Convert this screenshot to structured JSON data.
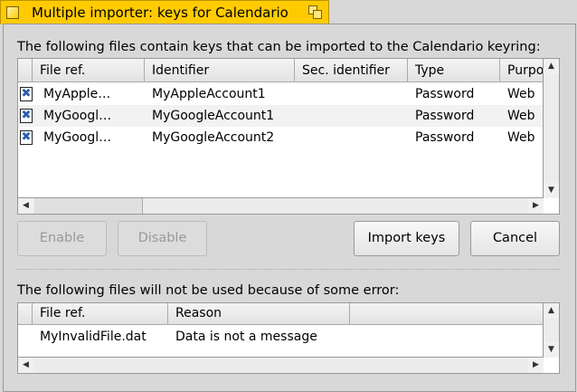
{
  "window": {
    "title": "Multiple importer: keys for Calendario",
    "accent": "#ffcb00"
  },
  "import_section": {
    "label": "The following files contain keys that can be imported to the Calendario keyring:",
    "columns": [
      "File ref.",
      "Identifier",
      "Sec. identifier",
      "Type",
      "Purpose"
    ],
    "columns_visible": [
      "File ref.",
      "Identifier",
      "Sec. identifier",
      "Type",
      "Purpo"
    ],
    "rows": [
      {
        "checked": true,
        "file_ref": "MyApple…",
        "identifier": "MyAppleAccount1",
        "sec_identifier": "",
        "type": "Password",
        "purpose": "Web"
      },
      {
        "checked": true,
        "file_ref": "MyGoogl…",
        "identifier": "MyGoogleAccount1",
        "sec_identifier": "",
        "type": "Password",
        "purpose": "Web"
      },
      {
        "checked": true,
        "file_ref": "MyGoogl…",
        "identifier": "MyGoogleAccount2",
        "sec_identifier": "",
        "type": "Password",
        "purpose": "Web"
      }
    ]
  },
  "buttons": {
    "enable": "Enable",
    "disable": "Disable",
    "import": "Import keys",
    "cancel": "Cancel"
  },
  "error_section": {
    "label": "The following files will not be used because of some error:",
    "columns": [
      "File ref.",
      "Reason"
    ],
    "rows": [
      {
        "file_ref": "MyInvalidFile.dat",
        "reason": "Data is not a message"
      }
    ]
  }
}
